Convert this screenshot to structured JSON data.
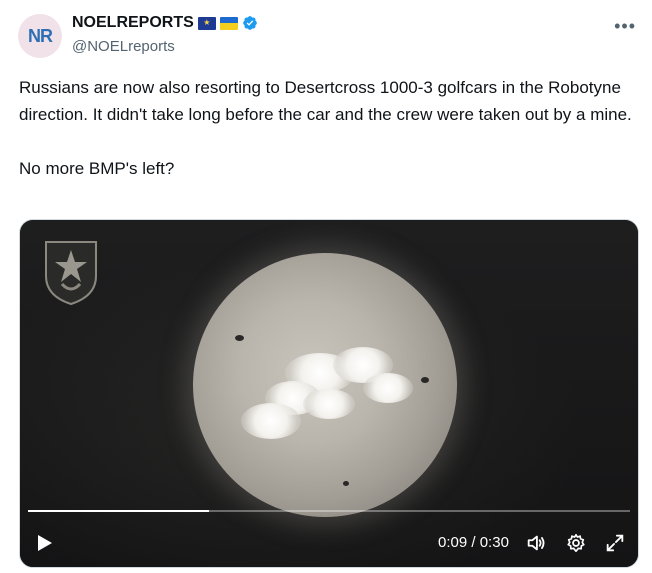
{
  "author": {
    "display_name": "NOELREPORTS",
    "handle": "@NOELreports",
    "avatar_text": "NR",
    "badges": [
      "eu-flag-icon",
      "ukraine-flag-icon",
      "verified-icon"
    ]
  },
  "header": {
    "more_label": "•••"
  },
  "tweet": {
    "paragraph1": "Russians are now also resorting to Desertcross 1000-3 golfcars in the Robotyne direction. It didn't take long before the car and the crew were taken out by a mine.",
    "paragraph2": "No more BMP's left?"
  },
  "video": {
    "current_time": "0:09",
    "separator": "/",
    "duration": "0:30",
    "progress_fraction": 0.3,
    "controls": [
      "play-icon",
      "volume-icon",
      "settings-gear-icon",
      "fullscreen-icon"
    ]
  },
  "colors": {
    "text": "#0f1419",
    "secondary_text": "#536471",
    "verified": "#1d9bf0",
    "video_bg": "#18181a"
  }
}
